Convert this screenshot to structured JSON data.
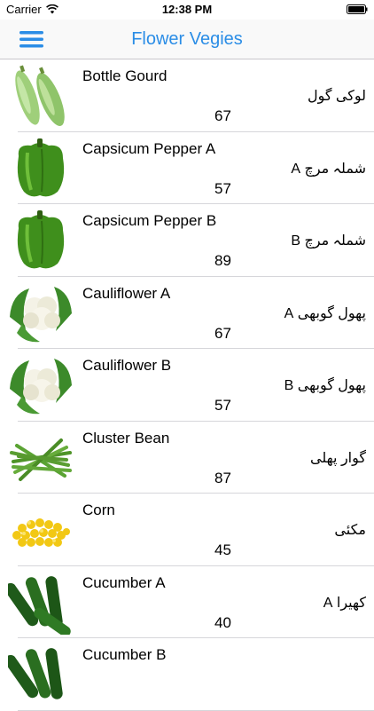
{
  "status_bar": {
    "carrier": "Carrier",
    "time": "12:38 PM",
    "icons": [
      "wifi-icon",
      "battery-icon"
    ]
  },
  "nav": {
    "title": "Flower Vegies",
    "menu_icon": "hamburger-menu-icon",
    "accent_color": "#2b8de6"
  },
  "items": [
    {
      "name": "Bottle Gourd",
      "urdu": "لوکی گول",
      "count": "67",
      "icon": "bottle-gourd-image"
    },
    {
      "name": "Capsicum Pepper A",
      "urdu": "شملہ مرچ A",
      "count": "57",
      "icon": "capsicum-image"
    },
    {
      "name": "Capsicum Pepper B",
      "urdu": "شملہ مرچ B",
      "count": "89",
      "icon": "capsicum-image"
    },
    {
      "name": "Cauliflower A",
      "urdu": "پھول گوبھی A",
      "count": "67",
      "icon": "cauliflower-image"
    },
    {
      "name": "Cauliflower B",
      "urdu": "پھول گوبھی B",
      "count": "57",
      "icon": "cauliflower-image"
    },
    {
      "name": "Cluster Bean",
      "urdu": "گوار پھلی",
      "count": "87",
      "icon": "cluster-bean-image"
    },
    {
      "name": "Corn",
      "urdu": "مکئی",
      "count": "45",
      "icon": "corn-image"
    },
    {
      "name": "Cucumber A",
      "urdu": "کھیرا A",
      "count": "40",
      "icon": "cucumber-image"
    },
    {
      "name": "Cucumber B",
      "urdu": "",
      "count": "",
      "icon": "cucumber-image"
    }
  ]
}
